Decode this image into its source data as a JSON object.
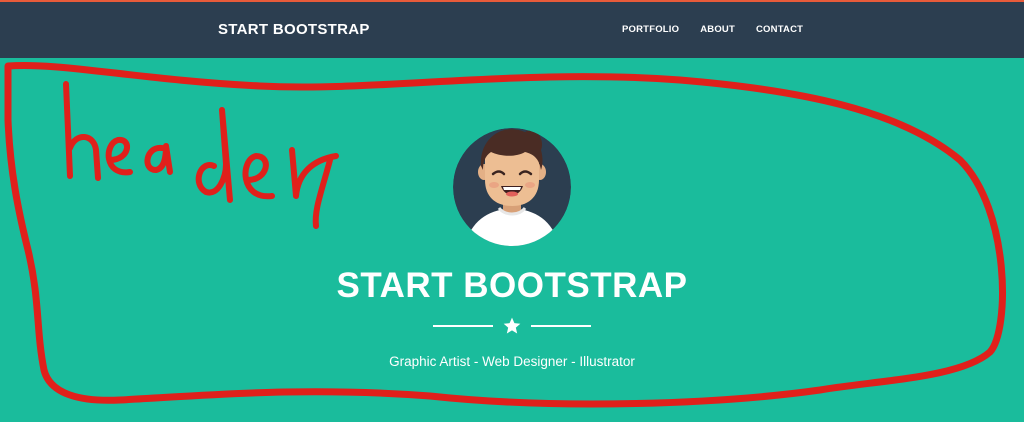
{
  "navbar": {
    "brand": "START BOOTSTRAP",
    "links": [
      {
        "label": "PORTFOLIO"
      },
      {
        "label": "ABOUT"
      },
      {
        "label": "CONTACT"
      }
    ]
  },
  "hero": {
    "title": "START BOOTSTRAP",
    "subtitle": "Graphic Artist - Web Designer - Illustrator",
    "divider_icon": "star-icon"
  },
  "annotation": {
    "handwritten_text": "header",
    "color": "#e0201b"
  },
  "colors": {
    "navbar": "#2c3e50",
    "hero_background": "#1abc9c",
    "text": "#ffffff"
  }
}
